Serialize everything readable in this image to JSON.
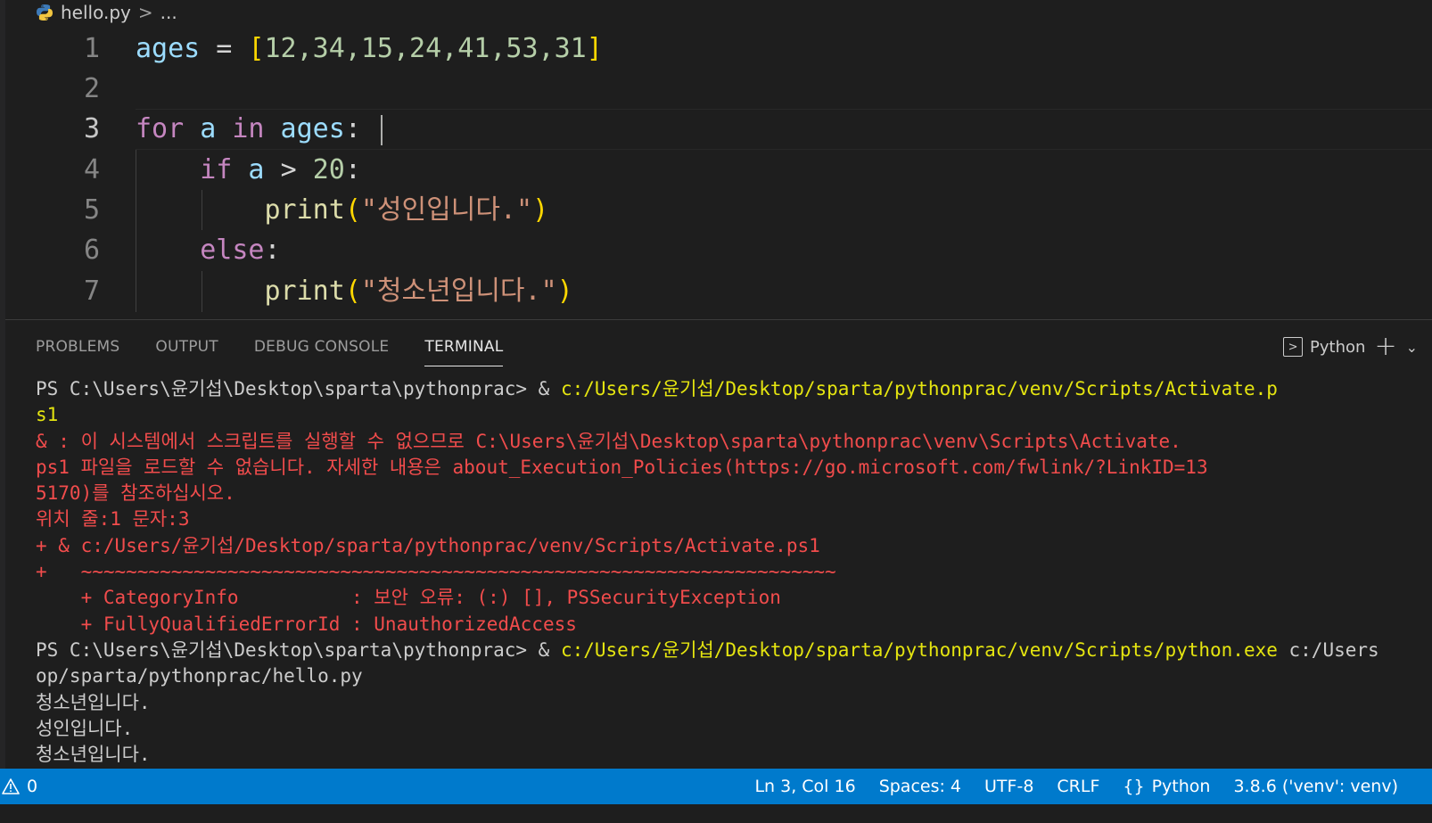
{
  "breadcrumb": {
    "file": "hello.py",
    "separator": ">",
    "more": "..."
  },
  "editor": {
    "line_numbers": [
      "1",
      "2",
      "3",
      "4",
      "5",
      "6",
      "7"
    ],
    "line1": {
      "var": "ages",
      "eq": " = ",
      "open": "[",
      "nums": "12,34,15,24,41,53,31",
      "close": "]"
    },
    "line3": {
      "kw_for": "for",
      "v_a": " a ",
      "kw_in": "in",
      "v_ages": " ages",
      "colon": ":"
    },
    "line4": {
      "kw_if": "if",
      "v_a": " a ",
      "op": "> ",
      "num": "20",
      "colon": ":"
    },
    "line5": {
      "fn": "print",
      "open": "(",
      "str": "\"성인입니다.\"",
      "close": ")"
    },
    "line6": {
      "kw_else": "else",
      "colon": ":"
    },
    "line7": {
      "fn": "print",
      "open": "(",
      "str": "\"청소년입니다.\"",
      "close": ")"
    }
  },
  "panel": {
    "tabs": [
      "PROBLEMS",
      "OUTPUT",
      "DEBUG CONSOLE",
      "TERMINAL"
    ],
    "active_tab": "TERMINAL",
    "terminal_profile": "Python",
    "icons": {
      "terminal": "terminal-icon",
      "add": "plus-icon",
      "dropdown": "chevron-down-icon"
    }
  },
  "terminal": {
    "l1_prompt": "PS C:\\Users\\윤기섭\\Desktop\\sparta\\pythonprac> & ",
    "l1_cmd": "c:/Users/윤기섭/Desktop/sparta/pythonprac/venv/Scripts/Activate.p",
    "l2": "s1",
    "l3": "& : 이 시스템에서 스크립트를 실행할 수 없으므로 C:\\Users\\윤기섭\\Desktop\\sparta\\pythonprac\\venv\\Scripts\\Activate.",
    "l4": "ps1 파일을 로드할 수 없습니다. 자세한 내용은 about_Execution_Policies(https://go.microsoft.com/fwlink/?LinkID=13",
    "l5": "5170)를 참조하십시오.",
    "l6": "위치 줄:1 문자:3",
    "l7": "+ & c:/Users/윤기섭/Desktop/sparta/pythonprac/venv/Scripts/Activate.ps1",
    "l8": "+   ~~~~~~~~~~~~~~~~~~~~~~~~~~~~~~~~~~~~~~~~~~~~~~~~~~~~~~~~~~~~~~~~~~~",
    "l9": "    + CategoryInfo          : 보안 오류: (:) [], PSSecurityException",
    "l10": "    + FullyQualifiedErrorId : UnauthorizedAccess",
    "l11_prompt": "PS C:\\Users\\윤기섭\\Desktop\\sparta\\pythonprac> & ",
    "l11_cmd": "c:/Users/윤기섭/Desktop/sparta/pythonprac/venv/Scripts/python.exe",
    "l11_tail": " c:/Users",
    "l12": "op/sparta/pythonprac/hello.py",
    "l13": "청소년입니다.",
    "l14": "성인입니다.",
    "l15": "청소년입니다."
  },
  "statusbar": {
    "warnings_count": "0",
    "cursor_position": "Ln 3, Col 16",
    "indentation": "Spaces: 4",
    "encoding": "UTF-8",
    "eol": "CRLF",
    "language": "Python",
    "interpreter": "3.8.6 ('venv': venv)",
    "colors": {
      "bar": "#007acc",
      "text": "#ffffff"
    }
  }
}
